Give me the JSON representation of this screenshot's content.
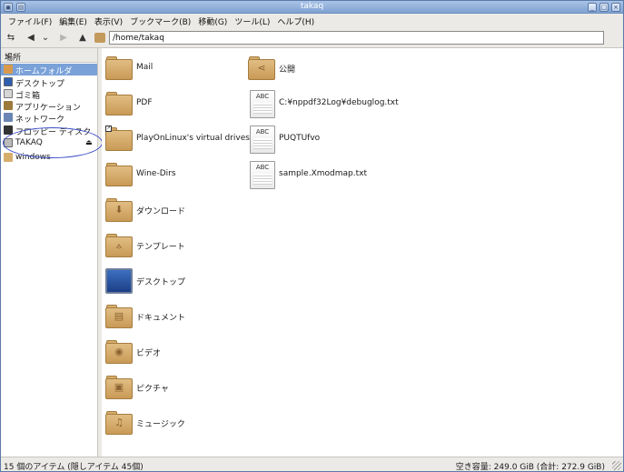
{
  "window": {
    "title": "takaq"
  },
  "menu": [
    "ファイル(F)",
    "編集(E)",
    "表示(V)",
    "ブックマーク(B)",
    "移動(G)",
    "ツール(L)",
    "ヘルプ(H)"
  ],
  "toolbar": {
    "location": "/home/takaq"
  },
  "sidebar": {
    "header": "場所",
    "items": [
      {
        "label": "ホームフォルダ",
        "icon": "home-folder-icon",
        "selected": true
      },
      {
        "label": "デスクトップ",
        "icon": "desktop-icon"
      },
      {
        "label": "ゴミ箱",
        "icon": "trash-icon"
      },
      {
        "label": "アプリケーション",
        "icon": "applications-icon"
      },
      {
        "label": "ネットワーク",
        "icon": "network-icon"
      },
      {
        "label": "フロッピー ディスク",
        "icon": "floppy-icon"
      },
      {
        "label": "TAKAQ",
        "icon": "drive-icon"
      },
      {
        "label": "windows",
        "icon": "folder-icon"
      }
    ]
  },
  "files": [
    {
      "name": "Mail",
      "type": "folder"
    },
    {
      "name": "PDF",
      "type": "folder"
    },
    {
      "name": "PlayOnLinux's virtual drives",
      "type": "folder-link"
    },
    {
      "name": "Wine-Dirs",
      "type": "folder"
    },
    {
      "name": "ダウンロード",
      "type": "folder-download"
    },
    {
      "name": "テンプレート",
      "type": "folder-templates"
    },
    {
      "name": "デスクトップ",
      "type": "desktop"
    },
    {
      "name": "ドキュメント",
      "type": "folder-documents"
    },
    {
      "name": "ビデオ",
      "type": "folder-videos"
    },
    {
      "name": "ピクチャ",
      "type": "folder-pictures"
    },
    {
      "name": "ミュージック",
      "type": "folder-music"
    },
    {
      "name": "公開",
      "type": "folder-public"
    },
    {
      "name": "C:¥nppdf32Log¥debuglog.txt",
      "type": "text"
    },
    {
      "name": "PUQTUfvo",
      "type": "text"
    },
    {
      "name": "sample.Xmodmap.txt",
      "type": "text"
    }
  ],
  "doc_icon_text": "ABC",
  "status": {
    "left": "15 個のアイテム (隠しアイテム 45個)",
    "right": "空き容量: 249.0 GiB (合計: 272.9 GiB)"
  },
  "colors": {
    "selection": "#7aa1d8",
    "folder": "#d7ad6c",
    "annotation": "#3a4ec8"
  }
}
